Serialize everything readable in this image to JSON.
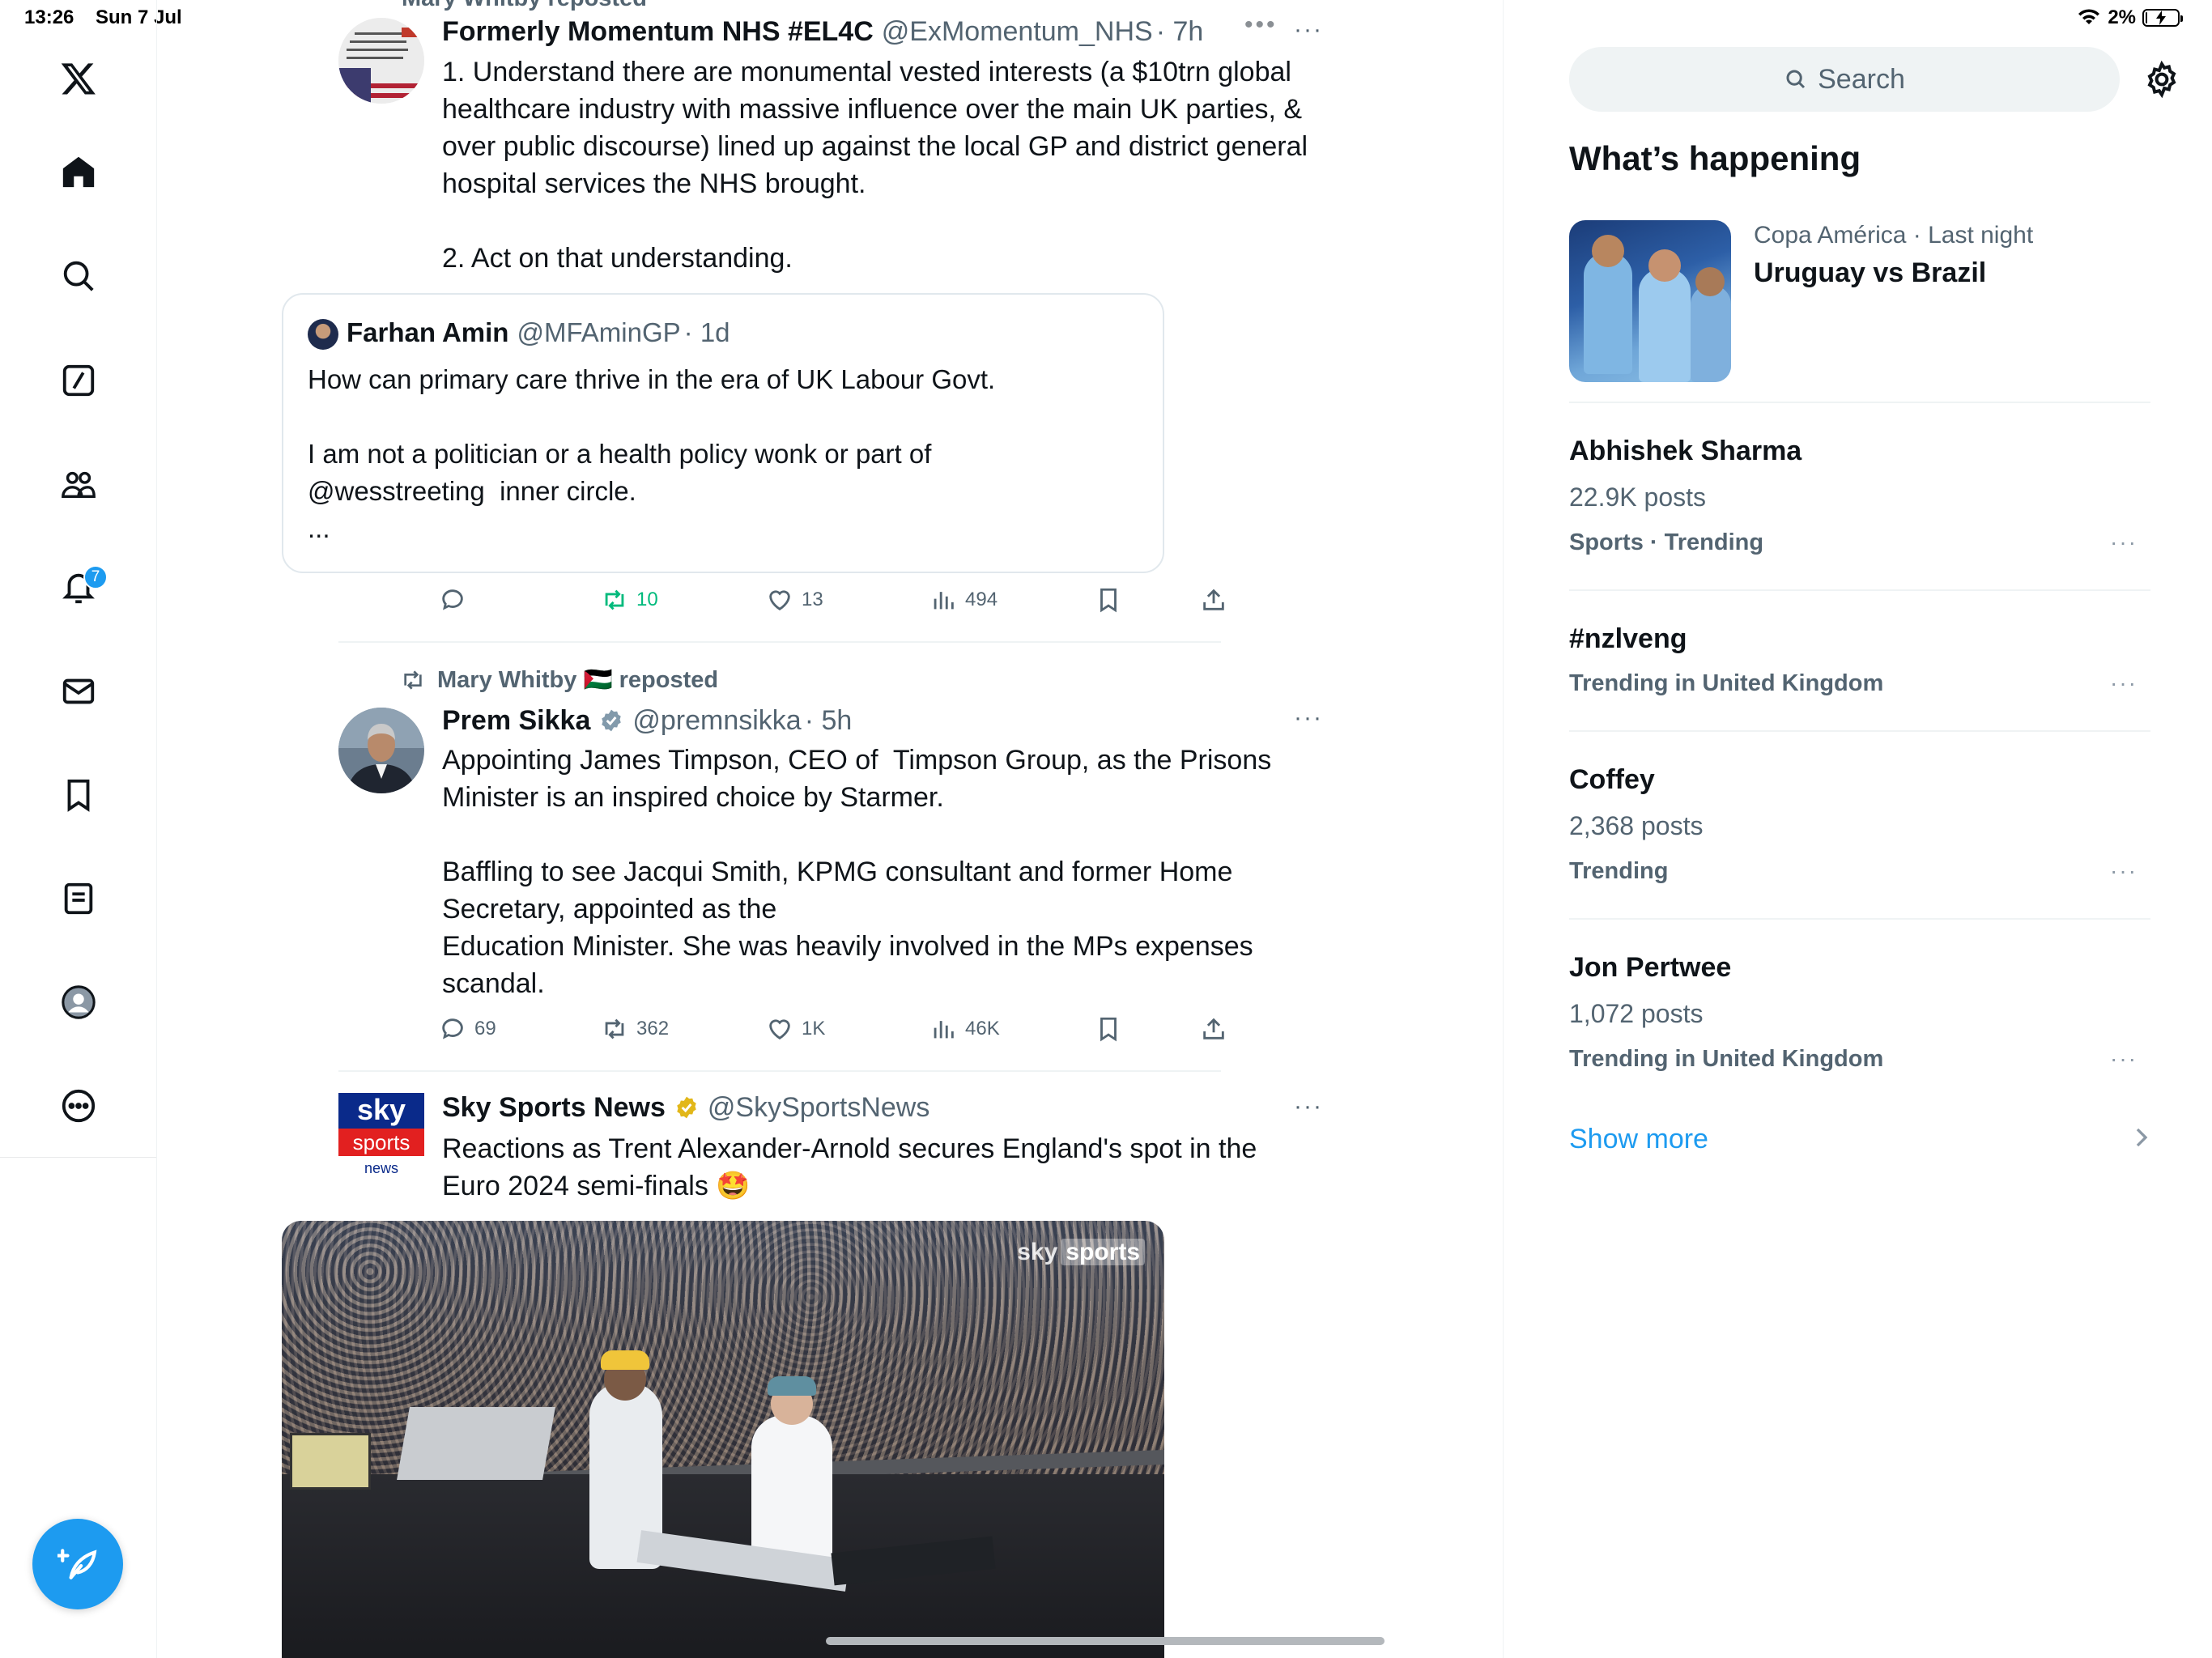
{
  "status_bar": {
    "time": "13:26",
    "date": "Sun 7 Jul",
    "battery": "2%"
  },
  "nav": {
    "items": [
      "home",
      "explore",
      "grok",
      "communities",
      "notifications",
      "messages",
      "bookmarks",
      "lists",
      "profile",
      "more"
    ],
    "notifications_badge": "7"
  },
  "tweets": [
    {
      "partial_header": "Mary Whitby reposted",
      "name": "Formerly Momentum NHS #EL4C",
      "handle": "@ExMomentum_NHS",
      "time": "· 7h",
      "more": "···",
      "text": "1. Understand there are monumental vested interests (a $10trn global\nhealthcare industry with massive influence over the main UK parties, &\nover public discourse) lined up against the local GP and district general\nhospital services the NHS brought.\n\n2. Act on that understanding.",
      "quote": {
        "name": "Farhan Amin",
        "handle": "@MFAminGP",
        "time": "· 1d",
        "text": "How can primary care thrive in the era of UK Labour Govt.\n\nI am not a politician or a health policy wonk or part of\n@wesstreeting  inner circle.\n..."
      },
      "actions": {
        "replies": "",
        "reposts": "10",
        "likes": "13",
        "views": "494"
      }
    },
    {
      "repost_label": "Mary Whitby 🇵🇸 reposted",
      "name": "Prem Sikka",
      "handle": "@premnsikka",
      "time": "· 5h",
      "more": "···",
      "text": "Appointing James Timpson, CEO of  Timpson Group, as the Prisons\nMinister is an inspired choice by Starmer.\n\nBaffling to see Jacqui Smith, KPMG consultant and former Home\nSecretary, appointed as the\nEducation Minister. She was heavily involved in the MPs expenses\nscandal.",
      "actions": {
        "replies": "69",
        "reposts": "362",
        "likes": "1K",
        "views": "46K"
      }
    },
    {
      "name": "Sky Sports News",
      "handle": "@SkySportsNews",
      "more": "···",
      "avatar_lines": [
        "sky",
        "sports",
        "news"
      ],
      "text": "Reactions as Trent Alexander-Arnold secures England's spot in the\nEuro 2024 semi-finals 🤩",
      "video_logo": [
        "sky",
        "sports"
      ]
    }
  ],
  "sidebar": {
    "search_placeholder": "Search",
    "section_title": "What’s happening",
    "featured": {
      "meta": "Copa América · Last night",
      "title": "Uruguay vs Brazil"
    },
    "trends": [
      {
        "title": "Abhishek Sharma",
        "count": "22.9K posts",
        "category": "Sports · Trending"
      },
      {
        "title": "#nzlveng",
        "count": "",
        "category": "Trending in United Kingdom"
      },
      {
        "title": "Coffey",
        "count": "2,368 posts",
        "category": "Trending"
      },
      {
        "title": "Jon Pertwee",
        "count": "1,072 posts",
        "category": "Trending in United Kingdom"
      }
    ],
    "trend_more": "···",
    "show_more": "Show more"
  },
  "colors": {
    "accent": "#1d9bf0",
    "repost_active": "#00ba7c",
    "text": "#0f1419",
    "secondary": "#536471"
  }
}
